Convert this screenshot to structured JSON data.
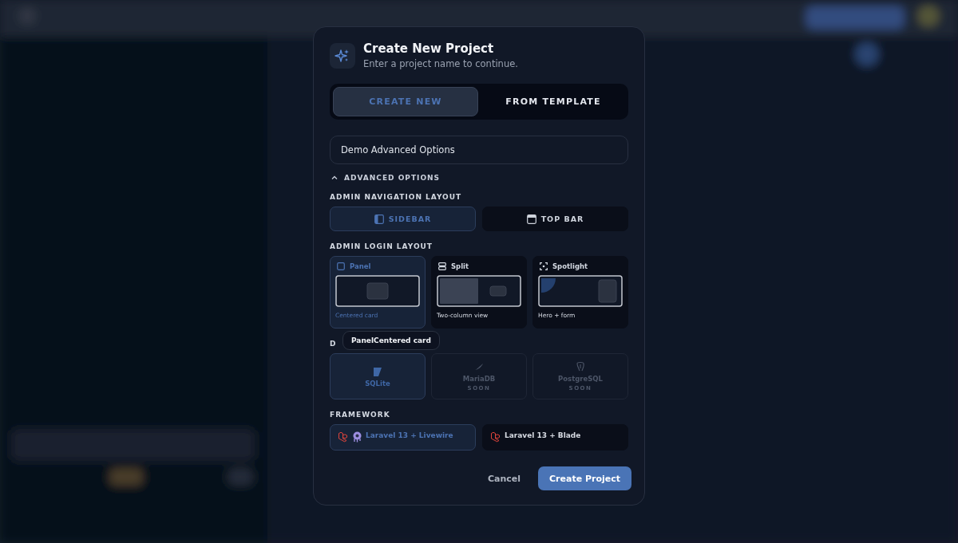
{
  "dialog": {
    "title": "Create New Project",
    "subtitle": "Enter a project name to continue."
  },
  "mode_tabs": [
    {
      "label": "CREATE NEW",
      "selected": true
    },
    {
      "label": "FROM TEMPLATE",
      "selected": false
    }
  ],
  "project_name": {
    "value": "Demo Advanced Options"
  },
  "advanced_options": {
    "label": "ADVANCED OPTIONS",
    "expanded": true
  },
  "nav_layout": {
    "label": "ADMIN NAVIGATION LAYOUT",
    "options": [
      {
        "label": "SIDEBAR",
        "kind": "sidebar",
        "selected": true
      },
      {
        "label": "TOP BAR",
        "kind": "topbar",
        "selected": false
      }
    ]
  },
  "login_layout": {
    "label": "ADMIN LOGIN LAYOUT",
    "options": [
      {
        "label": "Panel",
        "caption": "Centered card",
        "kind": "panel",
        "selected": true
      },
      {
        "label": "Split",
        "caption": "Two-column view",
        "kind": "split",
        "selected": false
      },
      {
        "label": "Spotlight",
        "caption": "Hero + form",
        "kind": "spotlight",
        "selected": false
      }
    ]
  },
  "tooltip": {
    "text": "PanelCentered card"
  },
  "database": {
    "label": "D",
    "options": [
      {
        "name": "SQLite",
        "kind": "sqlite",
        "selected": true,
        "disabled": false
      },
      {
        "name": "MariaDB",
        "badge": "SOON",
        "kind": "mariadb",
        "selected": false,
        "disabled": true
      },
      {
        "name": "PostgreSQL",
        "badge": "SOON",
        "kind": "postgres",
        "selected": false,
        "disabled": true
      }
    ]
  },
  "framework": {
    "label": "FRAMEWORK",
    "options": [
      {
        "label": "Laravel 13 + Livewire",
        "kind": "livewire",
        "selected": true
      },
      {
        "label": "Laravel 13 + Blade",
        "kind": "blade",
        "selected": false
      }
    ]
  },
  "buttons": {
    "cancel": "Cancel",
    "create": "Create Project"
  }
}
